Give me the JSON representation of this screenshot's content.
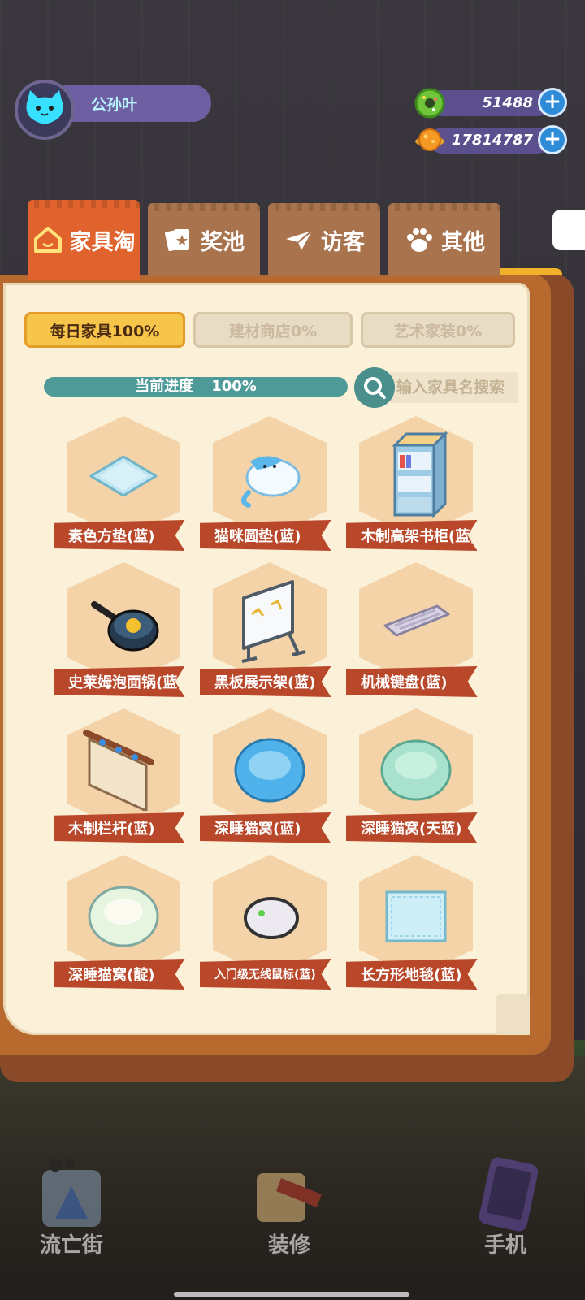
{
  "player": {
    "name": "公孙叶"
  },
  "currency": [
    {
      "icon": "green-donut-coin-icon",
      "value": "51488",
      "add_label": "+"
    },
    {
      "icon": "orange-planet-coin-icon",
      "value": "17814787",
      "add_label": "+"
    }
  ],
  "tabs": [
    {
      "label": "家具淘",
      "icon": "house-icon",
      "active": true
    },
    {
      "label": "奖池",
      "icon": "card-icon",
      "active": false
    },
    {
      "label": "访客",
      "icon": "paper-plane-icon",
      "active": false
    },
    {
      "label": "其他",
      "icon": "paw-icon",
      "active": false
    }
  ],
  "subtabs": [
    {
      "label": "每日家具100%",
      "active": true
    },
    {
      "label": "建材商店0%",
      "active": false
    },
    {
      "label": "艺术家装0%",
      "active": false
    }
  ],
  "progress": {
    "label": "当前进度",
    "value_text": "100%",
    "value": 1.0
  },
  "search": {
    "placeholder": "输入家具名搜索"
  },
  "items": [
    {
      "name": "素色方垫(蓝)",
      "icon": "square-cushion-icon"
    },
    {
      "name": "猫咪圆垫(蓝)",
      "icon": "cat-cushion-icon"
    },
    {
      "name": "木制高架书柜(蓝)",
      "icon": "bookshelf-icon"
    },
    {
      "name": "史莱姆泡面锅(蓝)",
      "icon": "frying-pan-icon"
    },
    {
      "name": "黑板展示架(蓝)",
      "icon": "blackboard-icon"
    },
    {
      "name": "机械键盘(蓝)",
      "icon": "keyboard-icon"
    },
    {
      "name": "木制栏杆(蓝)",
      "icon": "wooden-railing-icon"
    },
    {
      "name": "深睡猫窝(蓝)",
      "icon": "blue-cat-bed-icon"
    },
    {
      "name": "深睡猫窝(天蓝)",
      "icon": "sky-blue-cat-bed-icon"
    },
    {
      "name": "深睡猫窝(靛)",
      "icon": "indigo-cat-bed-icon"
    },
    {
      "name": "入门级无线鼠标(蓝)",
      "icon": "wireless-mouse-icon"
    },
    {
      "name": "长方形地毯(蓝)",
      "icon": "rectangle-rug-icon"
    }
  ],
  "bottom_nav": [
    {
      "label": "流亡街",
      "icon": "street-icon"
    },
    {
      "label": "装修",
      "icon": "decorate-icon"
    },
    {
      "label": "手机",
      "icon": "phone-icon"
    }
  ],
  "colors": {
    "tab_active": "#e0622c",
    "tab_inactive": "#a9744d",
    "page": "#fbf0d8",
    "ribbon": "#b9472a",
    "progress_fill": "#4d9a98",
    "subtab_active": "#f7c54a"
  }
}
